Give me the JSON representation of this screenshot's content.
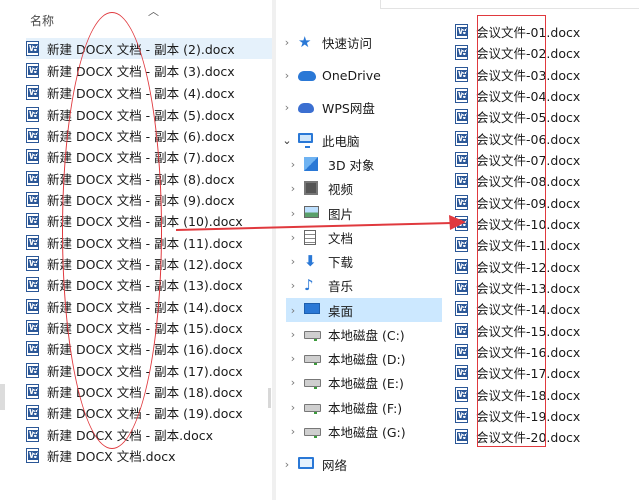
{
  "left_pane": {
    "column_header": "名称",
    "files": [
      "新建 DOCX 文档 - 副本 (2).docx",
      "新建 DOCX 文档 - 副本 (3).docx",
      "新建 DOCX 文档 - 副本 (4).docx",
      "新建 DOCX 文档 - 副本 (5).docx",
      "新建 DOCX 文档 - 副本 (6).docx",
      "新建 DOCX 文档 - 副本 (7).docx",
      "新建 DOCX 文档 - 副本 (8).docx",
      "新建 DOCX 文档 - 副本 (9).docx",
      "新建 DOCX 文档 - 副本 (10).docx",
      "新建 DOCX 文档 - 副本 (11).docx",
      "新建 DOCX 文档 - 副本 (12).docx",
      "新建 DOCX 文档 - 副本 (13).docx",
      "新建 DOCX 文档 - 副本 (14).docx",
      "新建 DOCX 文档 - 副本 (15).docx",
      "新建 DOCX 文档 - 副本 (16).docx",
      "新建 DOCX 文档 - 副本 (17).docx",
      "新建 DOCX 文档 - 副本 (18).docx",
      "新建 DOCX 文档 - 副本 (19).docx",
      "新建 DOCX 文档 - 副本.docx",
      "新建 DOCX 文档.docx"
    ]
  },
  "nav_pane": {
    "items": [
      {
        "label": "快速访问",
        "icon": "star-icon"
      },
      {
        "label": "OneDrive",
        "icon": "cloud-icon"
      },
      {
        "label": "WPS网盘",
        "icon": "wps-cloud-icon"
      },
      {
        "label": "此电脑",
        "icon": "computer-icon"
      },
      {
        "label": "3D 对象",
        "icon": "cube-icon"
      },
      {
        "label": "视频",
        "icon": "video-icon"
      },
      {
        "label": "图片",
        "icon": "picture-icon"
      },
      {
        "label": "文档",
        "icon": "document-icon"
      },
      {
        "label": "下载",
        "icon": "download-icon"
      },
      {
        "label": "音乐",
        "icon": "music-icon"
      },
      {
        "label": "桌面",
        "icon": "desktop-icon"
      },
      {
        "label": "本地磁盘 (C:)",
        "icon": "drive-icon"
      },
      {
        "label": "本地磁盘 (D:)",
        "icon": "drive-icon"
      },
      {
        "label": "本地磁盘 (E:)",
        "icon": "drive-icon"
      },
      {
        "label": "本地磁盘 (F:)",
        "icon": "drive-icon"
      },
      {
        "label": "本地磁盘 (G:)",
        "icon": "drive-icon"
      },
      {
        "label": "网络",
        "icon": "network-icon"
      }
    ]
  },
  "right_pane": {
    "files": [
      "会议文件-01.docx",
      "会议文件-02.docx",
      "会议文件-03.docx",
      "会议文件-04.docx",
      "会议文件-05.docx",
      "会议文件-06.docx",
      "会议文件-07.docx",
      "会议文件-08.docx",
      "会议文件-09.docx",
      "会议文件-10.docx",
      "会议文件-11.docx",
      "会议文件-12.docx",
      "会议文件-13.docx",
      "会议文件-14.docx",
      "会议文件-15.docx",
      "会议文件-16.docx",
      "会议文件-17.docx",
      "会议文件-18.docx",
      "会议文件-19.docx",
      "会议文件-20.docx"
    ]
  },
  "colors": {
    "annotation_red": "#e0393e",
    "selection_blue": "#e5f1fb",
    "nav_active": "#cce8ff",
    "word_blue": "#2b5797"
  }
}
